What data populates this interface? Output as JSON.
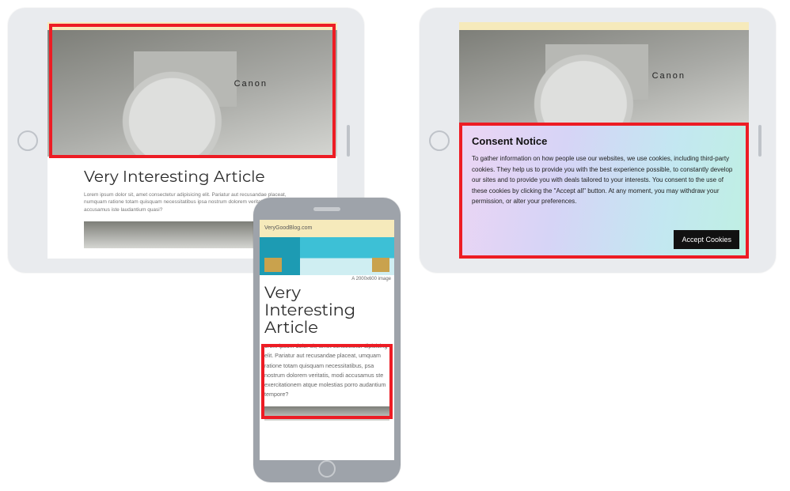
{
  "article": {
    "title": "Very Interesting Article",
    "lorem_short": "Lorem ipsum dolor sit, amet consectetur adipisicing elit. Pariatur aut recusandae placeat, numquam ratione totam quisquam necessitatibus ipsa nostrum dolorem veritatis, modi accusamus iste laudantium quasi?",
    "camera_brand": "Canon"
  },
  "phone": {
    "site": "VeryGoodBlog.com",
    "title": "Very Interesting Article",
    "caption": "A 2000x600 image",
    "lorem": "orem ipsum dolor sit, amet consectetur dipisicing elit. Pariatur aut recusandae placeat, umquam ratione totam quisquam necessitatibus, psa nostrum dolorem veritatis, modi accusamus ste exercitationem atque molestias porro audantium tempore?"
  },
  "consent": {
    "heading": "Consent Notice",
    "body": "To gather information on how people use our websites, we use cookies, including third-party cookies. They help us to provide you with the best experience possible, to constantly develop our sites and to provide you with deals tailored to your interests. You consent to the use of these cookies by clicking the \"Accept all\" button. At any moment, you may withdraw your permission, or alter your preferences.",
    "button": "Accept Cookies"
  }
}
